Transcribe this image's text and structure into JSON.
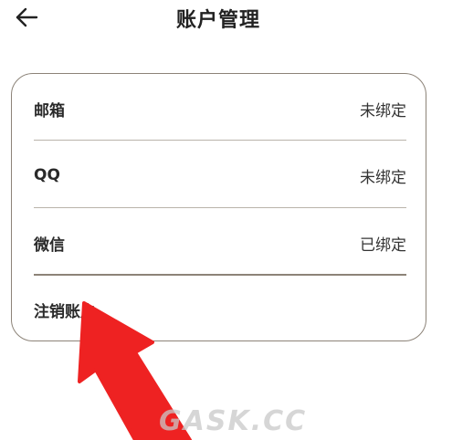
{
  "header": {
    "title": "账户管理",
    "back_icon": "arrow-left-icon"
  },
  "account": {
    "rows": [
      {
        "label": "邮箱",
        "value": "未绑定"
      },
      {
        "label": "QQ",
        "value": "未绑定"
      },
      {
        "label": "微信",
        "value": "已绑定"
      }
    ],
    "delete_label": "注销账户"
  },
  "colors": {
    "card_border": "#8c8378",
    "arrow": "#ee2222"
  },
  "watermark": {
    "text": "GASK.CC"
  }
}
